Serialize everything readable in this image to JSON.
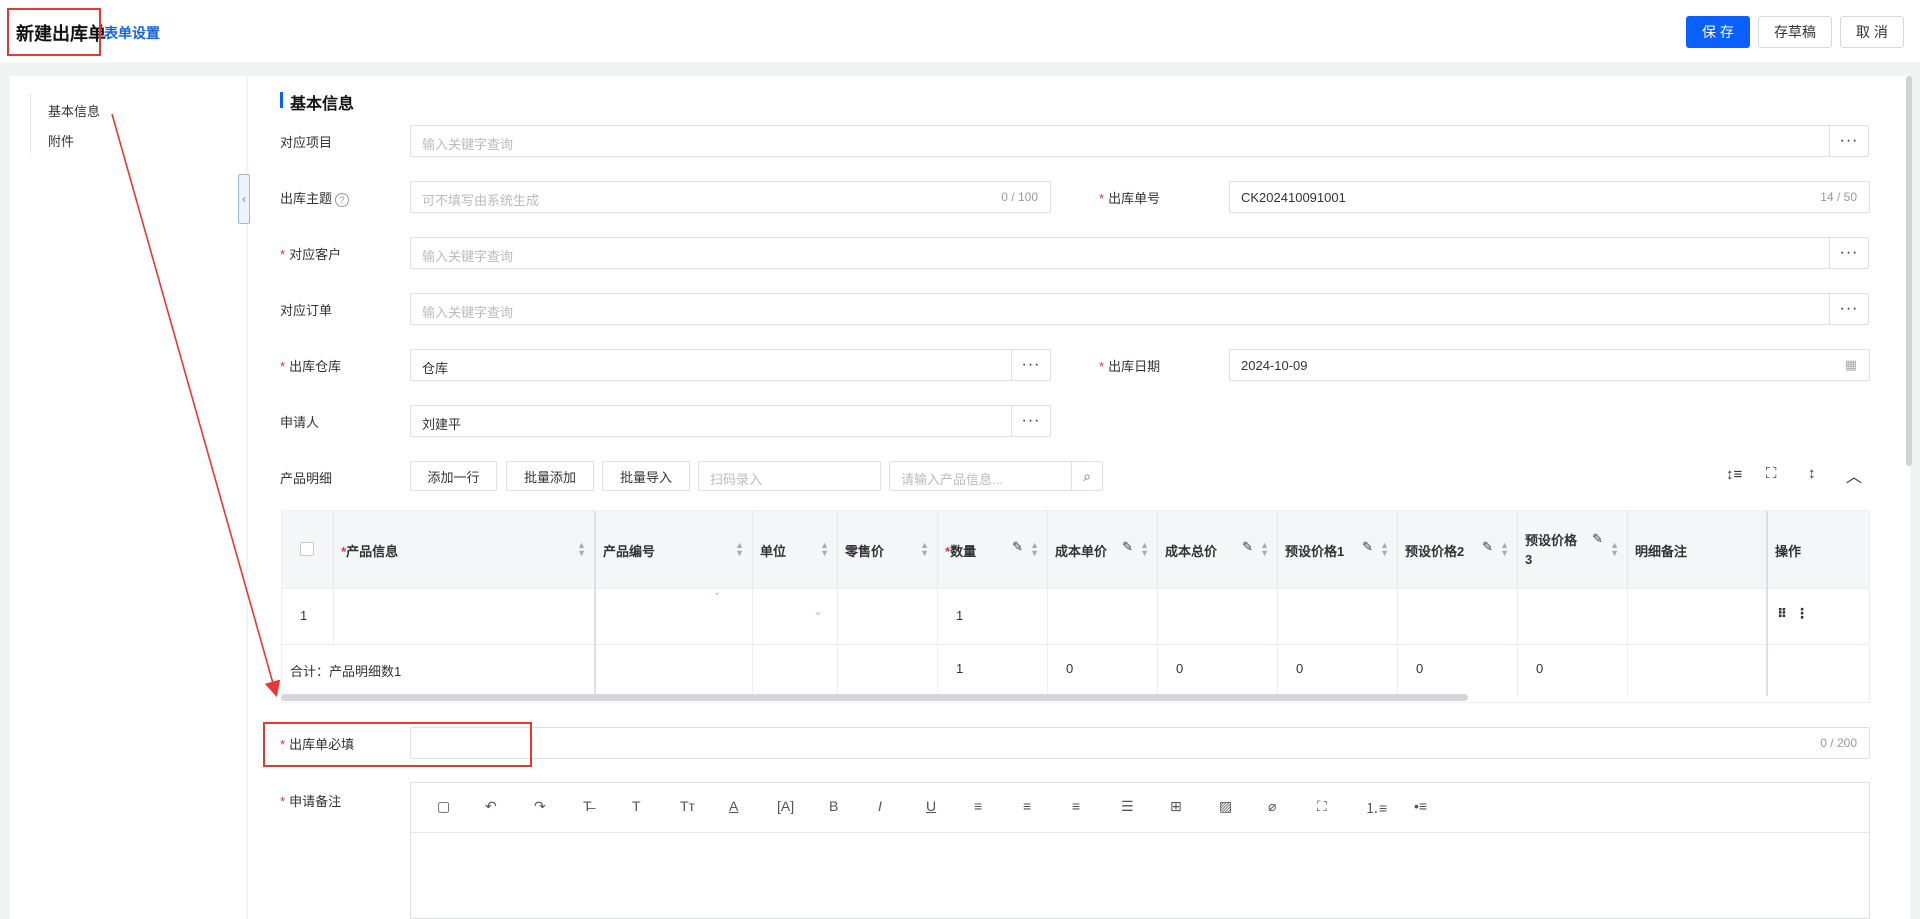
{
  "header": {
    "title": "新建出库单",
    "form_settings": "表单设置",
    "save": "保 存",
    "draft": "存草稿",
    "cancel": "取 消"
  },
  "nav": {
    "items": [
      "基本信息",
      "附件"
    ]
  },
  "section": {
    "title": "基本信息"
  },
  "fields": {
    "project": {
      "label": "对应项目",
      "placeholder": "输入关键字查询"
    },
    "subject": {
      "label": "出库主题",
      "placeholder": "可不填写由系统生成",
      "count": "0 / 100"
    },
    "order_no": {
      "label": "出库单号",
      "value": "CK202410091001",
      "count": "14 / 50"
    },
    "customer": {
      "label": "对应客户",
      "placeholder": "输入关键字查询"
    },
    "order": {
      "label": "对应订单",
      "placeholder": "输入关键字查询"
    },
    "warehouse": {
      "label": "出库仓库",
      "value": "仓库"
    },
    "date": {
      "label": "出库日期",
      "value": "2024-10-09"
    },
    "applicant": {
      "label": "申请人",
      "value": "刘建平"
    },
    "required": {
      "label": "出库单必填",
      "count": "0 / 200"
    },
    "remark": {
      "label": "申请备注"
    }
  },
  "products": {
    "label": "产品明细",
    "add_row": "添加一行",
    "batch_add": "批量添加",
    "batch_import": "批量导入",
    "scan_placeholder": "扫码录入",
    "search_placeholder": "请输入产品信息..."
  },
  "table": {
    "headers": {
      "product_info": "产品信息",
      "product_code": "产品编号",
      "unit": "单位",
      "retail_price": "零售价",
      "quantity": "数量",
      "cost_unit": "成本单价",
      "cost_total": "成本总价",
      "preset1": "预设价格1",
      "preset2": "预设价格2",
      "preset3_a": "预设价格",
      "preset3_b": "3",
      "note": "明细备注",
      "action": "操作"
    },
    "row": {
      "index": "1",
      "quantity": "1"
    },
    "total": {
      "label": "合计：产品明细数1",
      "quantity": "1",
      "cost_unit": "0",
      "cost_total": "0",
      "preset1": "0",
      "preset2": "0",
      "preset3": "0"
    }
  },
  "colors": {
    "accent": "#0a5fff",
    "annotation": "#e53935"
  }
}
